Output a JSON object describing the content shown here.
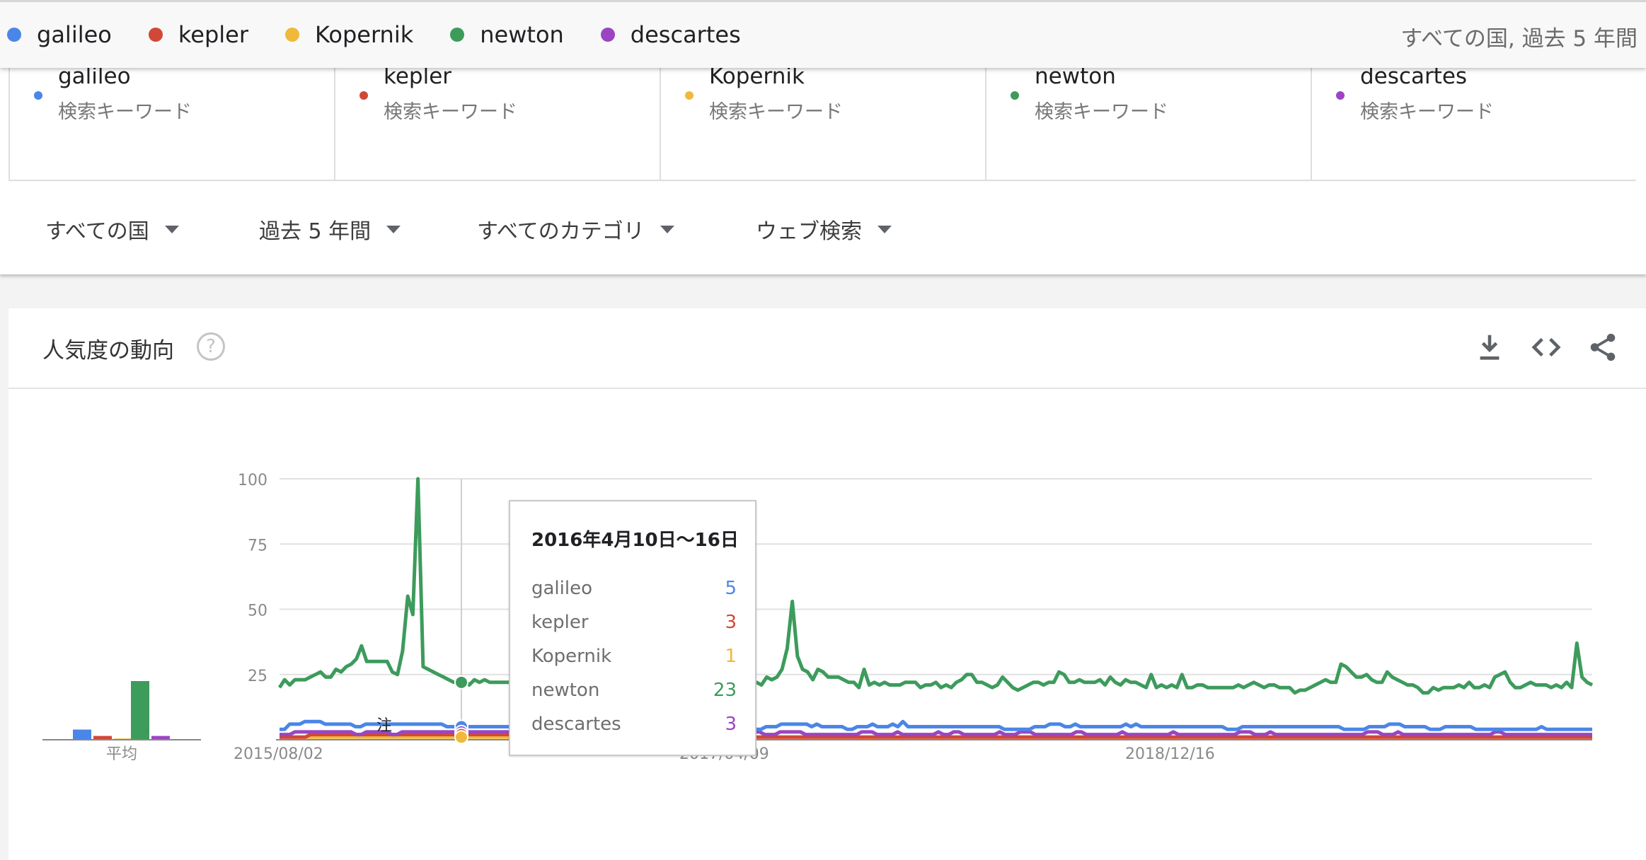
{
  "top_legend": [
    {
      "label": "galileo",
      "color": "#4a86e8"
    },
    {
      "label": "kepler",
      "color": "#d14836"
    },
    {
      "label": "Kopernik",
      "color": "#f0b93a"
    },
    {
      "label": "newton",
      "color": "#3d9b5c"
    },
    {
      "label": "descartes",
      "color": "#9c45c2"
    }
  ],
  "top_right_text": "すべての国, 過去 5 年間",
  "terms": [
    {
      "name": "galileo",
      "sub": "検索キーワード"
    },
    {
      "name": "kepler",
      "sub": "検索キーワード"
    },
    {
      "name": "Kopernik",
      "sub": "検索キーワード"
    },
    {
      "name": "newton",
      "sub": "検索キーワード"
    },
    {
      "name": "descartes",
      "sub": "検索キーワード"
    }
  ],
  "filters": [
    "すべての国",
    "過去 5 年間",
    "すべてのカテゴリ",
    "ウェブ検索"
  ],
  "card": {
    "title": "人気度の動向",
    "help": "?"
  },
  "icons": {
    "download": "download-icon",
    "embed": "embed-code-icon",
    "share": "share-icon"
  },
  "tooltip": {
    "title": "2016年4月10日〜16日",
    "rows": [
      {
        "label": "galileo",
        "value": "5",
        "color": "#4a86e8"
      },
      {
        "label": "kepler",
        "value": "3",
        "color": "#d14836"
      },
      {
        "label": "Kopernik",
        "value": "1",
        "color": "#f0b93a"
      },
      {
        "label": "newton",
        "value": "23",
        "color": "#3d9b5c"
      },
      {
        "label": "descartes",
        "value": "3",
        "color": "#9c45c2"
      }
    ]
  },
  "chart_data": {
    "type": "line",
    "ylim": [
      0,
      100
    ],
    "yticks": [
      "100",
      "75",
      "50",
      "25"
    ],
    "xticks": [
      "2015/08/02",
      "2017/04/09",
      "2018/12/16"
    ],
    "average_label": "平均",
    "note_marker": "注",
    "averages": [
      {
        "name": "galileo",
        "value": 4,
        "color": "#4a86e8"
      },
      {
        "name": "kepler",
        "value": 1.5,
        "color": "#d14836"
      },
      {
        "name": "Kopernik",
        "value": 0.5,
        "color": "#f0b93a"
      },
      {
        "name": "newton",
        "value": 23,
        "color": "#3d9b5c"
      },
      {
        "name": "descartes",
        "value": 1.5,
        "color": "#9c45c2"
      }
    ],
    "series": [
      {
        "name": "newton",
        "color": "#3d9b5c",
        "values": [
          20,
          23,
          21,
          23,
          23,
          23,
          24,
          25,
          26,
          24,
          24,
          27,
          26,
          28,
          29,
          31,
          36,
          30,
          30,
          30,
          30,
          30,
          26,
          25,
          34,
          55,
          48,
          100,
          28,
          27,
          26,
          25,
          24,
          23,
          22,
          22,
          23,
          21,
          23,
          22,
          23,
          22,
          22,
          22,
          22,
          22,
          22,
          21,
          21,
          21,
          20,
          21,
          21,
          22,
          25,
          25,
          26,
          35,
          31,
          30,
          28,
          25,
          24,
          24,
          23,
          22,
          22,
          21,
          21,
          22,
          22,
          21,
          22,
          22,
          22,
          22,
          21,
          20,
          19,
          18,
          27,
          22,
          20,
          19,
          19,
          19,
          19,
          19,
          20,
          20,
          21,
          22,
          23,
          22,
          21,
          24,
          23,
          24,
          27,
          35,
          53,
          32,
          27,
          26,
          23,
          27,
          26,
          24,
          24,
          24,
          23,
          22,
          22,
          20,
          27,
          21,
          22,
          21,
          22,
          21,
          21,
          21,
          22,
          22,
          22,
          20,
          21,
          21,
          22,
          20,
          21,
          20,
          22,
          23,
          25,
          25,
          22,
          22,
          21,
          20,
          21,
          24,
          22,
          20,
          19,
          20,
          21,
          22,
          22,
          21,
          22,
          22,
          26,
          25,
          22,
          22,
          23,
          22,
          22,
          22,
          23,
          21,
          24,
          22,
          21,
          23,
          22,
          22,
          21,
          20,
          25,
          20,
          21,
          20,
          21,
          20,
          25,
          20,
          20,
          21,
          21,
          20,
          20,
          20,
          20,
          20,
          20,
          21,
          20,
          21,
          22,
          21,
          20,
          21,
          21,
          20,
          20,
          20,
          18,
          19,
          19,
          20,
          21,
          22,
          23,
          22,
          22,
          29,
          28,
          26,
          24,
          24,
          25,
          23,
          22,
          22,
          26,
          24,
          23,
          22,
          21,
          21,
          20,
          18,
          18,
          20,
          19,
          20,
          20,
          20,
          21,
          20,
          22,
          20,
          20,
          21,
          20,
          24,
          25,
          26,
          22,
          20,
          20,
          21,
          22,
          21,
          21,
          21,
          20,
          21,
          20,
          22,
          20,
          37,
          24,
          22,
          21
        ]
      },
      {
        "name": "galileo",
        "color": "#4a86e8",
        "values": [
          4,
          4,
          6,
          6,
          6,
          7,
          7,
          7,
          7,
          6,
          6,
          6,
          6,
          6,
          6,
          5,
          5,
          6,
          6,
          6,
          6,
          6,
          6,
          6,
          6,
          6,
          6,
          6,
          6,
          6,
          6,
          6,
          6,
          5,
          5,
          5,
          5,
          5,
          5,
          5,
          5,
          5,
          5,
          5,
          5,
          5,
          5,
          5,
          5,
          5,
          5,
          5,
          5,
          5,
          5,
          5,
          5,
          5,
          5,
          5,
          5,
          5,
          5,
          5,
          5,
          5,
          5,
          5,
          5,
          5,
          5,
          5,
          5,
          5,
          5,
          5,
          5,
          5,
          5,
          5,
          5,
          5,
          5,
          5,
          4,
          4,
          4,
          4,
          4,
          4,
          4,
          4,
          4,
          4,
          4,
          4,
          5,
          5,
          5,
          6,
          6,
          6,
          6,
          6,
          6,
          5,
          6,
          5,
          5,
          5,
          5,
          5,
          4,
          4,
          5,
          5,
          5,
          6,
          5,
          5,
          5,
          6,
          5,
          7,
          5,
          5,
          5,
          5,
          5,
          5,
          5,
          5,
          5,
          5,
          5,
          5,
          5,
          5,
          5,
          5,
          5,
          5,
          5,
          4,
          4,
          4,
          4,
          4,
          4,
          5,
          5,
          5,
          6,
          6,
          6,
          5,
          5,
          6,
          5,
          5,
          5,
          5,
          5,
          5,
          5,
          5,
          5,
          6,
          5,
          6,
          5,
          5,
          5,
          5,
          5,
          5,
          5,
          5,
          5,
          5,
          5,
          5,
          5,
          5,
          5,
          5,
          5,
          4,
          4,
          4,
          5,
          5,
          5,
          5,
          5,
          5,
          5,
          5,
          5,
          5,
          5,
          5,
          5,
          5,
          5,
          5,
          5,
          5,
          5,
          5,
          4,
          4,
          4,
          4,
          4,
          5,
          5,
          5,
          5,
          6,
          6,
          6,
          5,
          5,
          5,
          5,
          5,
          4,
          4,
          4,
          5,
          5,
          5,
          5,
          5,
          5,
          4,
          4,
          4,
          4,
          4,
          4,
          4,
          4,
          4,
          4,
          4,
          4,
          4,
          5,
          4,
          4,
          4,
          4,
          4,
          4,
          4,
          4,
          4,
          4
        ]
      },
      {
        "name": "descartes",
        "color": "#9c45c2",
        "values": [
          2,
          2,
          2,
          3,
          3,
          3,
          3,
          3,
          3,
          3,
          3,
          3,
          3,
          3,
          3,
          2,
          2,
          3,
          3,
          3,
          3,
          3,
          2,
          2,
          3,
          3,
          3,
          3,
          3,
          3,
          3,
          3,
          3,
          3,
          3,
          3,
          3,
          3,
          3,
          3,
          3,
          3,
          3,
          3,
          3,
          3,
          3,
          3,
          3,
          3,
          3,
          3,
          3,
          3,
          3,
          3,
          3,
          3,
          3,
          3,
          3,
          3,
          3,
          3,
          3,
          3,
          3,
          3,
          2,
          2,
          2,
          2,
          2,
          2,
          2,
          2,
          2,
          2,
          2,
          2,
          2,
          2,
          2,
          2,
          2,
          2,
          2,
          2,
          2,
          2,
          2,
          3,
          3,
          3,
          3,
          2,
          2,
          2,
          3,
          3,
          3,
          3,
          3,
          2,
          2,
          2,
          2,
          2,
          2,
          2,
          2,
          2,
          2,
          2,
          3,
          3,
          3,
          2,
          2,
          2,
          2,
          3,
          2,
          2,
          2,
          2,
          2,
          2,
          2,
          3,
          2,
          2,
          3,
          3,
          2,
          2,
          2,
          2,
          2,
          2,
          2,
          3,
          2,
          2,
          2,
          3,
          3,
          3,
          2,
          2,
          2,
          2,
          2,
          2,
          2,
          2,
          3,
          3,
          2,
          2,
          2,
          2,
          2,
          2,
          2,
          3,
          2,
          2,
          2,
          2,
          2,
          2,
          2,
          2,
          2,
          3,
          2,
          2,
          2,
          2,
          2,
          2,
          2,
          2,
          2,
          2,
          2,
          2,
          3,
          3,
          3,
          2,
          2,
          2,
          3,
          2,
          2,
          2,
          2,
          2,
          2,
          2,
          2,
          2,
          2,
          2,
          2,
          2,
          2,
          2,
          2,
          2,
          2,
          3,
          3,
          3,
          2,
          2,
          2,
          3,
          2,
          2,
          2,
          2,
          2,
          2,
          2,
          2,
          2,
          2,
          2,
          2,
          2,
          2,
          2,
          2,
          2,
          2,
          3,
          3,
          2,
          2,
          2,
          2,
          2,
          2,
          2,
          2,
          2,
          2,
          2,
          2,
          2,
          2,
          2,
          2,
          2,
          2
        ]
      },
      {
        "name": "kepler",
        "color": "#d14836",
        "values": [
          1,
          1,
          1,
          1,
          1,
          1,
          2,
          2,
          2,
          2,
          2,
          2,
          2,
          2,
          2,
          2,
          2,
          2,
          2,
          2,
          2,
          2,
          2,
          2,
          2,
          2,
          2,
          2,
          2,
          2,
          2,
          2,
          2,
          2,
          2,
          2,
          2,
          2,
          2,
          2,
          2,
          2,
          2,
          2,
          2,
          2,
          2,
          2,
          2,
          2,
          2,
          2,
          2,
          2,
          2,
          2,
          2,
          2,
          2,
          2,
          2,
          2,
          2,
          2,
          2,
          2,
          2,
          1,
          1,
          1,
          1,
          1,
          1,
          1,
          1,
          1,
          1,
          1,
          1,
          1,
          1,
          1,
          1,
          1,
          1,
          1,
          1,
          1,
          1,
          1,
          1,
          1,
          1,
          1,
          1,
          1,
          1,
          1,
          1,
          1,
          1,
          1,
          1,
          1,
          1,
          1,
          1,
          1,
          1,
          1,
          1,
          1,
          1,
          1,
          1,
          1,
          1,
          1,
          1,
          1,
          1,
          1,
          1,
          1,
          1,
          1,
          1,
          1,
          1,
          1,
          1,
          1,
          1,
          1,
          1,
          1,
          1,
          1,
          1,
          1,
          1,
          1,
          1,
          1,
          1,
          1,
          1,
          1,
          1,
          1,
          1,
          1,
          1,
          1,
          1,
          1,
          1,
          1,
          1,
          1,
          1,
          1,
          1,
          1,
          1,
          1,
          1,
          1,
          1,
          1,
          1,
          1,
          1,
          1,
          1,
          1,
          1,
          1,
          1,
          1,
          1,
          1,
          1,
          1,
          1,
          1,
          1,
          1,
          1,
          1,
          1,
          1,
          1,
          1,
          1,
          1,
          1,
          1,
          1,
          1,
          1,
          1,
          1,
          1,
          1,
          1,
          1,
          1,
          1,
          1,
          1,
          1,
          1,
          1,
          1,
          1,
          1,
          1,
          1,
          1,
          1,
          1,
          1,
          1,
          1,
          1,
          1,
          1,
          1,
          1,
          1,
          1,
          1,
          1,
          1,
          1,
          1,
          1,
          1,
          1,
          1,
          1,
          1,
          1,
          1,
          1,
          1,
          1,
          1,
          1,
          1,
          1,
          1,
          1,
          1,
          1
        ]
      },
      {
        "name": "Kopernik",
        "color": "#f0b93a",
        "values": [
          1,
          1,
          1,
          1,
          1,
          1,
          1,
          1,
          1,
          1,
          1,
          1,
          1,
          1,
          1,
          1,
          1,
          1,
          1,
          1,
          1,
          1,
          1,
          1,
          1,
          1,
          1,
          1,
          1,
          1,
          1,
          1,
          1,
          1,
          1,
          1,
          1,
          1,
          1,
          1,
          1,
          1,
          1,
          1,
          1,
          1,
          1,
          1,
          1,
          1,
          1,
          1,
          1,
          1,
          1,
          1,
          1,
          1,
          1,
          1,
          1,
          1,
          1,
          1,
          1,
          1,
          1,
          1,
          1,
          1,
          1,
          1,
          1,
          1,
          1,
          1,
          1,
          1,
          1,
          1,
          1,
          1,
          1,
          1,
          1,
          1,
          1,
          1,
          1,
          1,
          1,
          1,
          1,
          1,
          1,
          1,
          1,
          1,
          1,
          1,
          1,
          1,
          1,
          1,
          1,
          1,
          1,
          1,
          1,
          1,
          1,
          1,
          1,
          1,
          1,
          1,
          1,
          1,
          1,
          1,
          1,
          1,
          1,
          1,
          1,
          1,
          1,
          1,
          1,
          1,
          1,
          1,
          1,
          1,
          1,
          1,
          1,
          1,
          1,
          1,
          1,
          1,
          1,
          1,
          1,
          1,
          1,
          1,
          1,
          1,
          1,
          1,
          1,
          1,
          1,
          1,
          1,
          1,
          1,
          1,
          1,
          1,
          1,
          1,
          1,
          1,
          1,
          1,
          1,
          1,
          1,
          1,
          1,
          1,
          1,
          1,
          1,
          1,
          1,
          1,
          1,
          1,
          1,
          1,
          1,
          1,
          1,
          1,
          1,
          1,
          1,
          1,
          1,
          1,
          1,
          1,
          1,
          1,
          1,
          1,
          1,
          1,
          1,
          1,
          1,
          1,
          1,
          1,
          1,
          1,
          1,
          1,
          1,
          1,
          1,
          1,
          1,
          1,
          1,
          1,
          1,
          1,
          1,
          1,
          1,
          1,
          1,
          1,
          1,
          1,
          1,
          1,
          1,
          1,
          1,
          1,
          1,
          1,
          1,
          1,
          1,
          1,
          1,
          1,
          1,
          1,
          1,
          1,
          1,
          1,
          1,
          1,
          1,
          1,
          1,
          1
        ]
      }
    ]
  }
}
